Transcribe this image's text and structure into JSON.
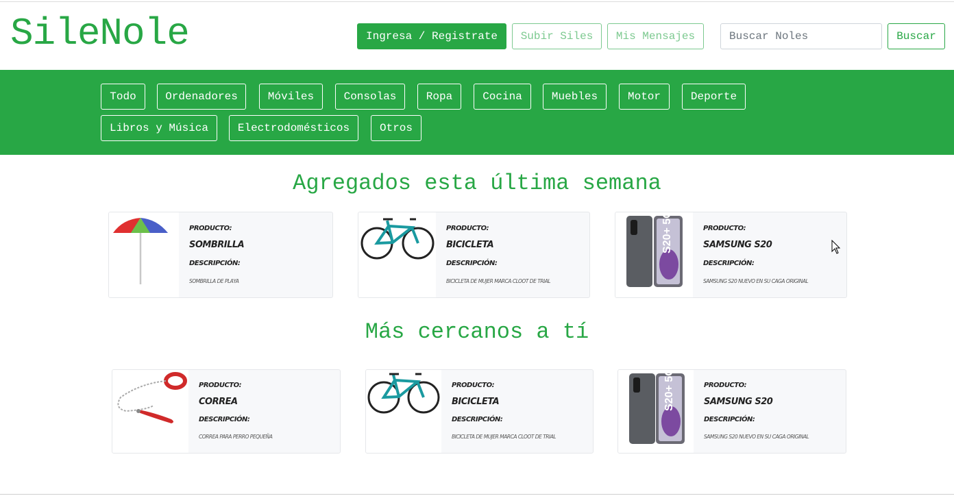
{
  "header": {
    "brand": "SileNole",
    "login_label": "Ingresa / Registrate",
    "upload_label": "Subir Siles",
    "messages_label": "Mis Mensajes",
    "search_placeholder": "Buscar Noles",
    "search_value": "",
    "search_button": "Buscar"
  },
  "categories": [
    "Todo",
    "Ordenadores",
    "Móviles",
    "Consolas",
    "Ropa",
    "Cocina",
    "Muebles",
    "Motor",
    "Deporte",
    "Libros y Música",
    "Electrodomésticos",
    "Otros"
  ],
  "sections": [
    {
      "title": "Agregados esta última semana",
      "cards": [
        {
          "label_product": "Producto:",
          "name": "Sombrilla",
          "label_description": "Descripción:",
          "description": "Sombrilla de playa",
          "image": "beach-umbrella"
        },
        {
          "label_product": "Producto:",
          "name": "Bicicleta",
          "label_description": "Descripción:",
          "description": "Bicicleta de mujer marca Cloot de trial",
          "image": "bicycle"
        },
        {
          "label_product": "Producto:",
          "name": "Samsung S20",
          "label_description": "Descripción:",
          "description": "Samsung S20 nuevo en su caga original",
          "image": "smartphone"
        }
      ]
    },
    {
      "title": "Más cercanos a tí",
      "cards": [
        {
          "label_product": "Producto:",
          "name": "Correa",
          "label_description": "Descripción:",
          "description": "Correa para perro pequeña",
          "image": "dog-leash"
        },
        {
          "label_product": "Producto:",
          "name": "Bicicleta",
          "label_description": "Descripción:",
          "description": "Bicicleta de mujer marca Cloot de trial",
          "image": "bicycle"
        },
        {
          "label_product": "Producto:",
          "name": "Samsung S20",
          "label_description": "Descripción:",
          "description": "Samsung S20 nuevo en su caga original",
          "image": "smartphone"
        }
      ]
    }
  ],
  "colors": {
    "brand_green": "#28a745",
    "light_green": "#7cc98f",
    "card_bg": "#f7f8fa"
  }
}
